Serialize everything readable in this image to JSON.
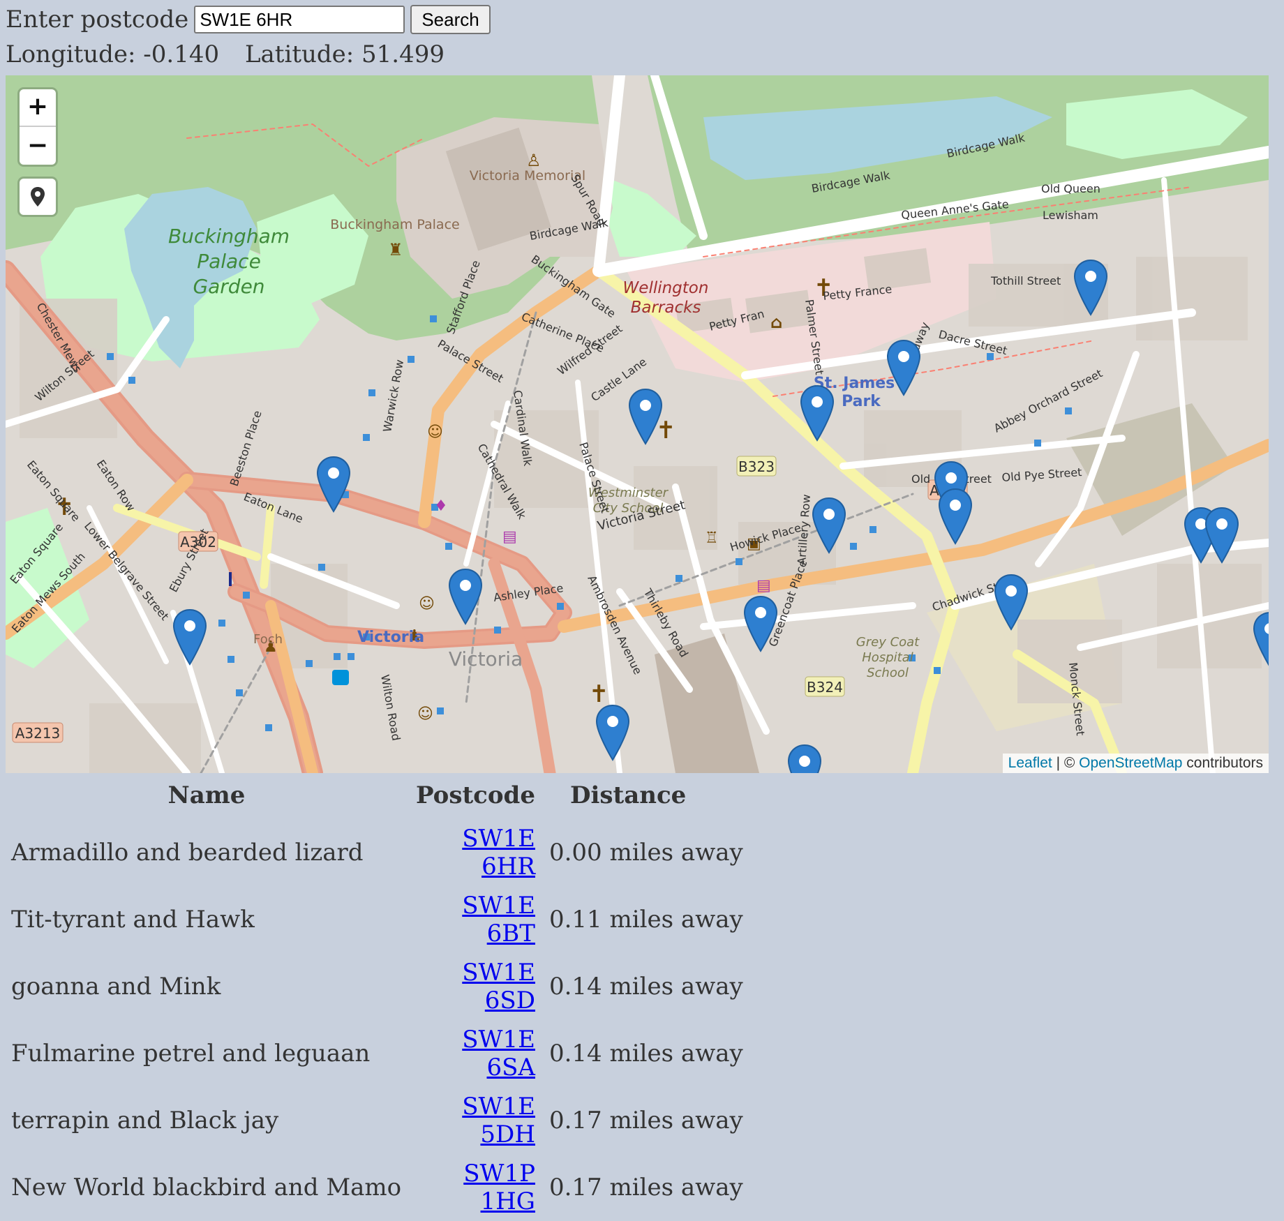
{
  "search": {
    "label": "Enter postcode",
    "value": "SW1E 6HR",
    "button_label": "Search"
  },
  "coords": {
    "longitude_text": "Longitude: -0.140",
    "latitude_text": "Latitude: 51.499"
  },
  "map": {
    "zoom_in": "+",
    "zoom_out": "−",
    "attribution_leaflet": "Leaflet",
    "attribution_sep": " | © ",
    "attribution_osm": "OpenStreetMap",
    "attribution_tail": " contributors",
    "labels": {
      "victoria_memorial": "Victoria Memorial",
      "buckingham_palace": "Buckingham Palace",
      "bpg_1": "Buckingham",
      "bpg_2": "Palace",
      "bpg_3": "Garden",
      "wellington_1": "Wellington",
      "wellington_2": "Barracks",
      "stjames_1": "St. James's",
      "stjames_2": "Park",
      "westminster_1": "Westminster",
      "westminster_2": "City School",
      "greycoat_1": "Grey Coat",
      "greycoat_2": "Hospital",
      "greycoat_3": "School",
      "victoria": "Victoria",
      "victoria_big": "Victoria",
      "foch": "Foch",
      "birdcage_walk": "Birdcage Walk",
      "birdcage_walk_2": "Birdcage Walk",
      "birdcage_walk_3": "Birdcage Walk",
      "buckingham_gate": "Buckingham Gate",
      "petty_france": "Petty France",
      "petty_france_2": "Petty Fran",
      "victoria_street": "Victoria Street",
      "palace_street": "Palace Street",
      "palace_street_2": "Palace Street",
      "stafford_place": "Stafford Place",
      "warwick_row": "Warwick Row",
      "cardinal_walk": "Cardinal Walk",
      "cathedral_walk": "Cathedral Walk",
      "castle_lane": "Castle Lane",
      "wilfred_street": "Wilfred Street",
      "catherine_place": "Catherine Place",
      "palmer_street": "Palmer Street",
      "broadway": "Broadway",
      "dacre_street": "Dacre Street",
      "tothill_street": "Tothill Street",
      "queen_annes_gate": "Queen Anne's Gate",
      "old_queen": "Old Queen",
      "lewisham": "Lewisham",
      "old_pye_street": "Old Pye Street",
      "old_pye_street_2": "Old Pye Street",
      "abbey_orchard": "Abbey Orchard Street",
      "artillery_row": "Artillery Row",
      "howick_place": "Howick Place",
      "chadwick_street": "Chadwick Street",
      "greencoat_place": "Greencoat Place",
      "thirleby_road": "Thirleby Road",
      "ambrosden": "Ambrosden Avenue",
      "ashley_place": "Ashley Place",
      "eaton_lane": "Eaton Lane",
      "beeston_place": "Beeston Place",
      "eaton_row": "Eaton Row",
      "eaton_square": "Eaton Square",
      "eaton_square_2": "Eaton Square",
      "lower_belgrave": "Lower Belgrave Street",
      "ebury_street": "Ebury Street",
      "eaton_mews_south": "Eaton Mews South",
      "chester_mews": "Chester Mews",
      "wilton_street": "Wilton Street",
      "wilton_road": "Wilton Road",
      "spur_road": "Spur Road",
      "monck_street": "Monck Street",
      "a302": "A302",
      "a302_2": "A302",
      "b323": "B323",
      "b324": "B324",
      "a3213": "A3213"
    }
  },
  "table": {
    "headers": [
      "Name",
      "Postcode",
      "Distance"
    ],
    "rows": [
      {
        "name": "Armadillo and bearded lizard",
        "postcode": "SW1E 6HR",
        "distance": "0.00 miles away"
      },
      {
        "name": "Tit-tyrant and Hawk",
        "postcode": "SW1E 6BT",
        "distance": "0.11 miles away"
      },
      {
        "name": "goanna and Mink",
        "postcode": "SW1E 6SD",
        "distance": "0.14 miles away"
      },
      {
        "name": "Fulmarine petrel and leguaan",
        "postcode": "SW1E 6SA",
        "distance": "0.14 miles away"
      },
      {
        "name": "terrapin and Black jay",
        "postcode": "SW1E 5DH",
        "distance": "0.17 miles away"
      },
      {
        "name": "New World blackbird and Mamo",
        "postcode": "SW1P 1HG",
        "distance": "0.17 miles away"
      }
    ]
  }
}
